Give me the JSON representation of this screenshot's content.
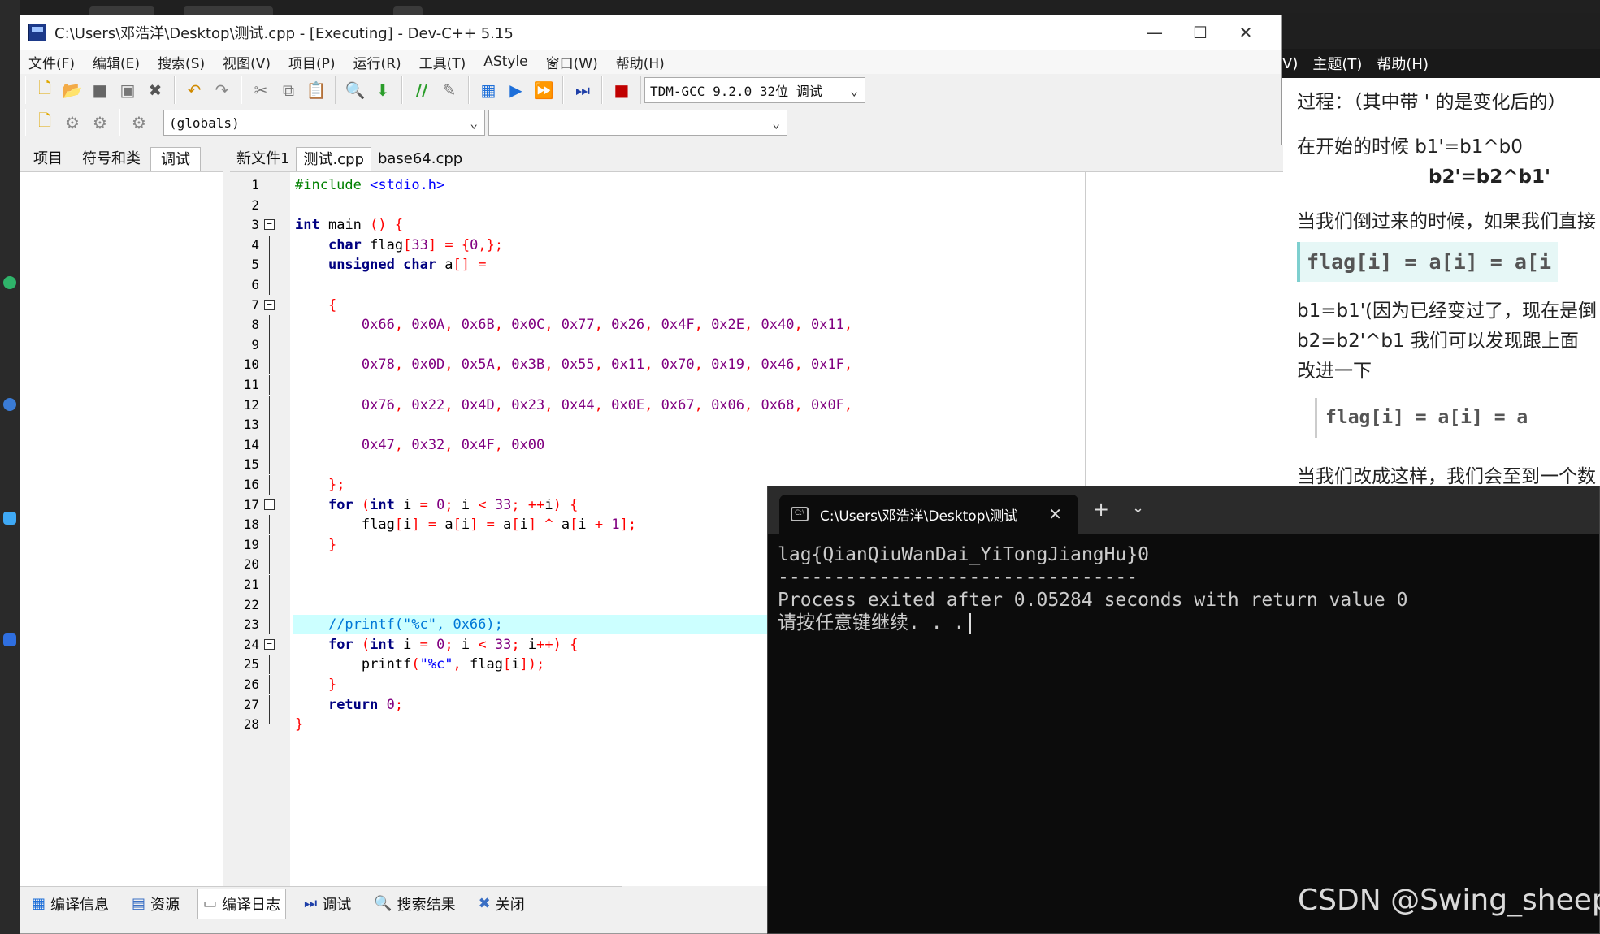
{
  "background": {
    "desktop_left_color": "#2a2a2a"
  },
  "document_window": {
    "menu": [
      "V)",
      "主题(T)",
      "帮助(H)"
    ],
    "lines": [
      "过程：（其中带 ' 的是变化后的）",
      "在开始的时候   b1'=b1^b0",
      "b2'=b2^b1'",
      "当我们倒过来的时候，如果我们直接",
      "flag[i] = a[i] = a[i",
      "b1=b1'(因为已经变过了，现在是倒",
      "b2=b2'^b1      我们可以发现跟上面",
      "改进一下",
      "flag[i] = a[i] = a",
      "当我们改成这样，我们会至到一个数"
    ]
  },
  "devcpp": {
    "title": "C:\\Users\\邓浩洋\\Desktop\\测试.cpp - [Executing] - Dev-C++ 5.15",
    "window_buttons": [
      "—",
      "☐",
      "✕"
    ],
    "menu": [
      "文件(F)",
      "编辑(E)",
      "搜索(S)",
      "视图(V)",
      "项目(P)",
      "运行(R)",
      "工具(T)",
      "AStyle",
      "窗口(W)",
      "帮助(H)"
    ],
    "compiler_select": "TDM-GCC 9.2.0 32位 调试",
    "scope_select": "(globals)",
    "member_select": "",
    "left_tabs": [
      "项目",
      "符号和类",
      "调试"
    ],
    "editor_tabs": [
      "新文件1",
      "测试.cpp",
      "base64.cpp"
    ],
    "bottom_tabs": [
      {
        "icon": "compile-info-icon",
        "label": "编译信息"
      },
      {
        "icon": "resources-icon",
        "label": "资源"
      },
      {
        "icon": "compile-log-icon",
        "label": "编译日志"
      },
      {
        "icon": "debug-icon",
        "label": "调试"
      },
      {
        "icon": "search-results-icon",
        "label": "搜索结果"
      },
      {
        "icon": "close-x-icon",
        "label": "关闭"
      }
    ],
    "code_lines": [
      {
        "n": "1",
        "text": "#include <stdio.h>"
      },
      {
        "n": "2",
        "text": ""
      },
      {
        "n": "3",
        "text": "int main () {"
      },
      {
        "n": "4",
        "text": "    char flag[33] = {0,};"
      },
      {
        "n": "5",
        "text": "    unsigned char a[] ="
      },
      {
        "n": "6",
        "text": ""
      },
      {
        "n": "7",
        "text": "    {"
      },
      {
        "n": "8",
        "text": "        0x66, 0x0A, 0x6B, 0x0C, 0x77, 0x26, 0x4F, 0x2E, 0x40, 0x11,"
      },
      {
        "n": "9",
        "text": ""
      },
      {
        "n": "10",
        "text": "        0x78, 0x0D, 0x5A, 0x3B, 0x55, 0x11, 0x70, 0x19, 0x46, 0x1F,"
      },
      {
        "n": "11",
        "text": ""
      },
      {
        "n": "12",
        "text": "        0x76, 0x22, 0x4D, 0x23, 0x44, 0x0E, 0x67, 0x06, 0x68, 0x0F,"
      },
      {
        "n": "13",
        "text": ""
      },
      {
        "n": "14",
        "text": "        0x47, 0x32, 0x4F, 0x00"
      },
      {
        "n": "15",
        "text": ""
      },
      {
        "n": "16",
        "text": "    };"
      },
      {
        "n": "17",
        "text": "    for (int i = 0; i < 33; ++i) {"
      },
      {
        "n": "18",
        "text": "        flag[i] = a[i] = a[i] ^ a[i + 1];"
      },
      {
        "n": "19",
        "text": "    }"
      },
      {
        "n": "20",
        "text": ""
      },
      {
        "n": "21",
        "text": ""
      },
      {
        "n": "22",
        "text": ""
      },
      {
        "n": "23",
        "text": "    //printf(\"%c\", 0x66);"
      },
      {
        "n": "24",
        "text": "    for (int i = 0; i < 33; i++) {"
      },
      {
        "n": "25",
        "text": "        printf(\"%c\", flag[i]);"
      },
      {
        "n": "26",
        "text": "    }"
      },
      {
        "n": "27",
        "text": "    return 0;"
      },
      {
        "n": "28",
        "text": "}"
      }
    ]
  },
  "terminal": {
    "tab_title": "C:\\Users\\邓浩洋\\Desktop\\测试",
    "plus": "+",
    "lines": [
      "lag{QianQiuWanDai_YiTongJiangHu}0",
      "--------------------------------",
      "Process exited after 0.05284 seconds with return value 0",
      "请按任意键继续. . ."
    ]
  },
  "watermark": "CSDN @Swing_sheep"
}
